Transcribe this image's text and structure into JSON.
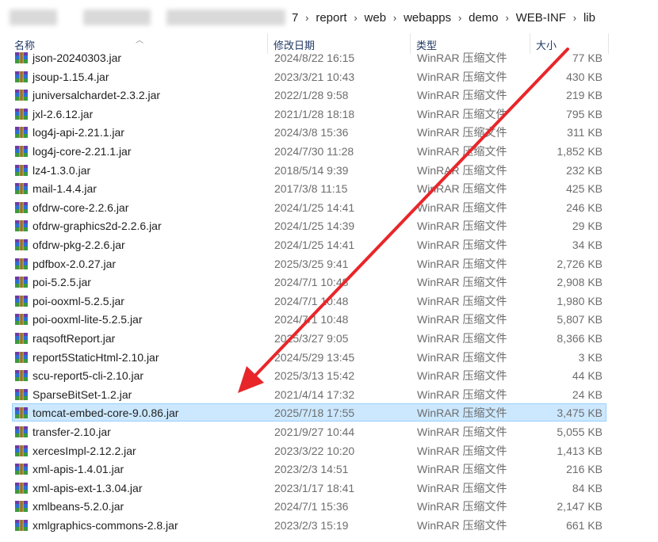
{
  "breadcrumb": {
    "partial_prefix": "7",
    "items": [
      "report",
      "web",
      "webapps",
      "demo",
      "WEB-INF",
      "lib"
    ],
    "separator_icon": "chevron-right-icon"
  },
  "columns": {
    "name": "名称",
    "date": "修改日期",
    "type": "类型",
    "size": "大小"
  },
  "files": [
    {
      "name": "json-20240303.jar",
      "date": "2024/8/22 16:15",
      "type": "WinRAR 压缩文件",
      "size": "77 KB"
    },
    {
      "name": "jsoup-1.15.4.jar",
      "date": "2023/3/21 10:43",
      "type": "WinRAR 压缩文件",
      "size": "430 KB"
    },
    {
      "name": "juniversalchardet-2.3.2.jar",
      "date": "2022/1/28 9:58",
      "type": "WinRAR 压缩文件",
      "size": "219 KB"
    },
    {
      "name": "jxl-2.6.12.jar",
      "date": "2021/1/28 18:18",
      "type": "WinRAR 压缩文件",
      "size": "795 KB"
    },
    {
      "name": "log4j-api-2.21.1.jar",
      "date": "2024/3/8 15:36",
      "type": "WinRAR 压缩文件",
      "size": "311 KB"
    },
    {
      "name": "log4j-core-2.21.1.jar",
      "date": "2024/7/30 11:28",
      "type": "WinRAR 压缩文件",
      "size": "1,852 KB"
    },
    {
      "name": "lz4-1.3.0.jar",
      "date": "2018/5/14 9:39",
      "type": "WinRAR 压缩文件",
      "size": "232 KB"
    },
    {
      "name": "mail-1.4.4.jar",
      "date": "2017/3/8 11:15",
      "type": "WinRAR 压缩文件",
      "size": "425 KB"
    },
    {
      "name": "ofdrw-core-2.2.6.jar",
      "date": "2024/1/25 14:41",
      "type": "WinRAR 压缩文件",
      "size": "246 KB"
    },
    {
      "name": "ofdrw-graphics2d-2.2.6.jar",
      "date": "2024/1/25 14:39",
      "type": "WinRAR 压缩文件",
      "size": "29 KB"
    },
    {
      "name": "ofdrw-pkg-2.2.6.jar",
      "date": "2024/1/25 14:41",
      "type": "WinRAR 压缩文件",
      "size": "34 KB"
    },
    {
      "name": "pdfbox-2.0.27.jar",
      "date": "2025/3/25 9:41",
      "type": "WinRAR 压缩文件",
      "size": "2,726 KB"
    },
    {
      "name": "poi-5.2.5.jar",
      "date": "2024/7/1 10:48",
      "type": "WinRAR 压缩文件",
      "size": "2,908 KB"
    },
    {
      "name": "poi-ooxml-5.2.5.jar",
      "date": "2024/7/1 10:48",
      "type": "WinRAR 压缩文件",
      "size": "1,980 KB"
    },
    {
      "name": "poi-ooxml-lite-5.2.5.jar",
      "date": "2024/7/1 10:48",
      "type": "WinRAR 压缩文件",
      "size": "5,807 KB"
    },
    {
      "name": "raqsoftReport.jar",
      "date": "2025/3/27 9:05",
      "type": "WinRAR 压缩文件",
      "size": "8,366 KB"
    },
    {
      "name": "report5StaticHtml-2.10.jar",
      "date": "2024/5/29 13:45",
      "type": "WinRAR 压缩文件",
      "size": "3 KB"
    },
    {
      "name": "scu-report5-cli-2.10.jar",
      "date": "2025/3/13 15:42",
      "type": "WinRAR 压缩文件",
      "size": "44 KB"
    },
    {
      "name": "SparseBitSet-1.2.jar",
      "date": "2021/4/14 17:32",
      "type": "WinRAR 压缩文件",
      "size": "24 KB"
    },
    {
      "name": "tomcat-embed-core-9.0.86.jar",
      "date": "2025/7/18 17:55",
      "type": "WinRAR 压缩文件",
      "size": "3,475 KB",
      "selected": true
    },
    {
      "name": "transfer-2.10.jar",
      "date": "2021/9/27 10:44",
      "type": "WinRAR 压缩文件",
      "size": "5,055 KB"
    },
    {
      "name": "xercesImpl-2.12.2.jar",
      "date": "2023/3/22 10:20",
      "type": "WinRAR 压缩文件",
      "size": "1,413 KB"
    },
    {
      "name": "xml-apis-1.4.01.jar",
      "date": "2023/2/3 14:51",
      "type": "WinRAR 压缩文件",
      "size": "216 KB"
    },
    {
      "name": "xml-apis-ext-1.3.04.jar",
      "date": "2023/1/17 18:41",
      "type": "WinRAR 压缩文件",
      "size": "84 KB"
    },
    {
      "name": "xmlbeans-5.2.0.jar",
      "date": "2024/7/1 15:36",
      "type": "WinRAR 压缩文件",
      "size": "2,147 KB"
    },
    {
      "name": "xmlgraphics-commons-2.8.jar",
      "date": "2023/2/3 15:19",
      "type": "WinRAR 压缩文件",
      "size": "661 KB"
    }
  ],
  "file_icon": "winrar-archive-icon",
  "colors": {
    "selected_bg": "#cce8ff",
    "selected_border": "#99d1ff",
    "annotation_arrow": "#e8262a",
    "header_text": "#1f3864",
    "secondary_text": "#6d6d6d"
  }
}
